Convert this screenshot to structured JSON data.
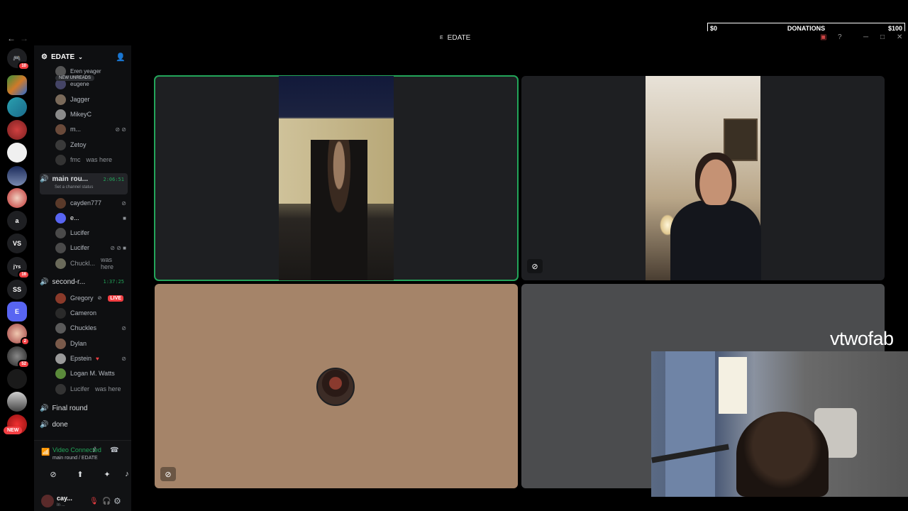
{
  "donations": {
    "min": "$0",
    "label": "DONATIONS",
    "max": "$100",
    "progress": 0
  },
  "window": {
    "title": "EDATE",
    "title_icon": "E"
  },
  "rail": {
    "badges": {
      "home": "10",
      "server7": "16",
      "server8": "2",
      "server9": "52"
    },
    "text_servers": [
      "a",
      "VS",
      "j'rs",
      "SS",
      "E"
    ],
    "new_label": "NEW"
  },
  "sidebar": {
    "server_name": "EDATE",
    "new_unreads": "NEW UNREADS",
    "partial_users": [
      "Eren yeager",
      "eugene"
    ],
    "group1": [
      {
        "name": "Jagger"
      },
      {
        "name": "MikeyC"
      },
      {
        "name": "m..."
      },
      {
        "name": "Zetoy"
      },
      {
        "name": "fmc",
        "note": "was here"
      }
    ],
    "main_channel": {
      "name": "main rou...",
      "timer": "2:06:51",
      "status": "Set a channel status"
    },
    "group2": [
      {
        "name": "cayden777"
      },
      {
        "name": "e..."
      },
      {
        "name": "Lucifer"
      },
      {
        "name": "Lucifer"
      },
      {
        "name": "Chuckl...",
        "note": "was here"
      }
    ],
    "second_channel": {
      "name": "second-r...",
      "timer": "1:37:25"
    },
    "group3": [
      {
        "name": "Gregory",
        "live": "LIVE"
      },
      {
        "name": "Cameron"
      },
      {
        "name": "Chuckles"
      },
      {
        "name": "Dylan"
      },
      {
        "name": "Epstein"
      },
      {
        "name": "Logan M. Watts"
      },
      {
        "name": "Lucifer",
        "note": "was here"
      }
    ],
    "other_channels": [
      "Final round",
      "done"
    ]
  },
  "voice": {
    "status": "Video Connected",
    "location": "main round / EDATE",
    "user_name": "cay...",
    "user_sub": "In ..."
  },
  "overlay": {
    "streamer_name": "vtwofab"
  },
  "colors": {
    "accent_green": "#23a55a",
    "live_red": "#f23f43",
    "tile_tan": "#a58469",
    "tile_gray": "#4b4c4e"
  }
}
